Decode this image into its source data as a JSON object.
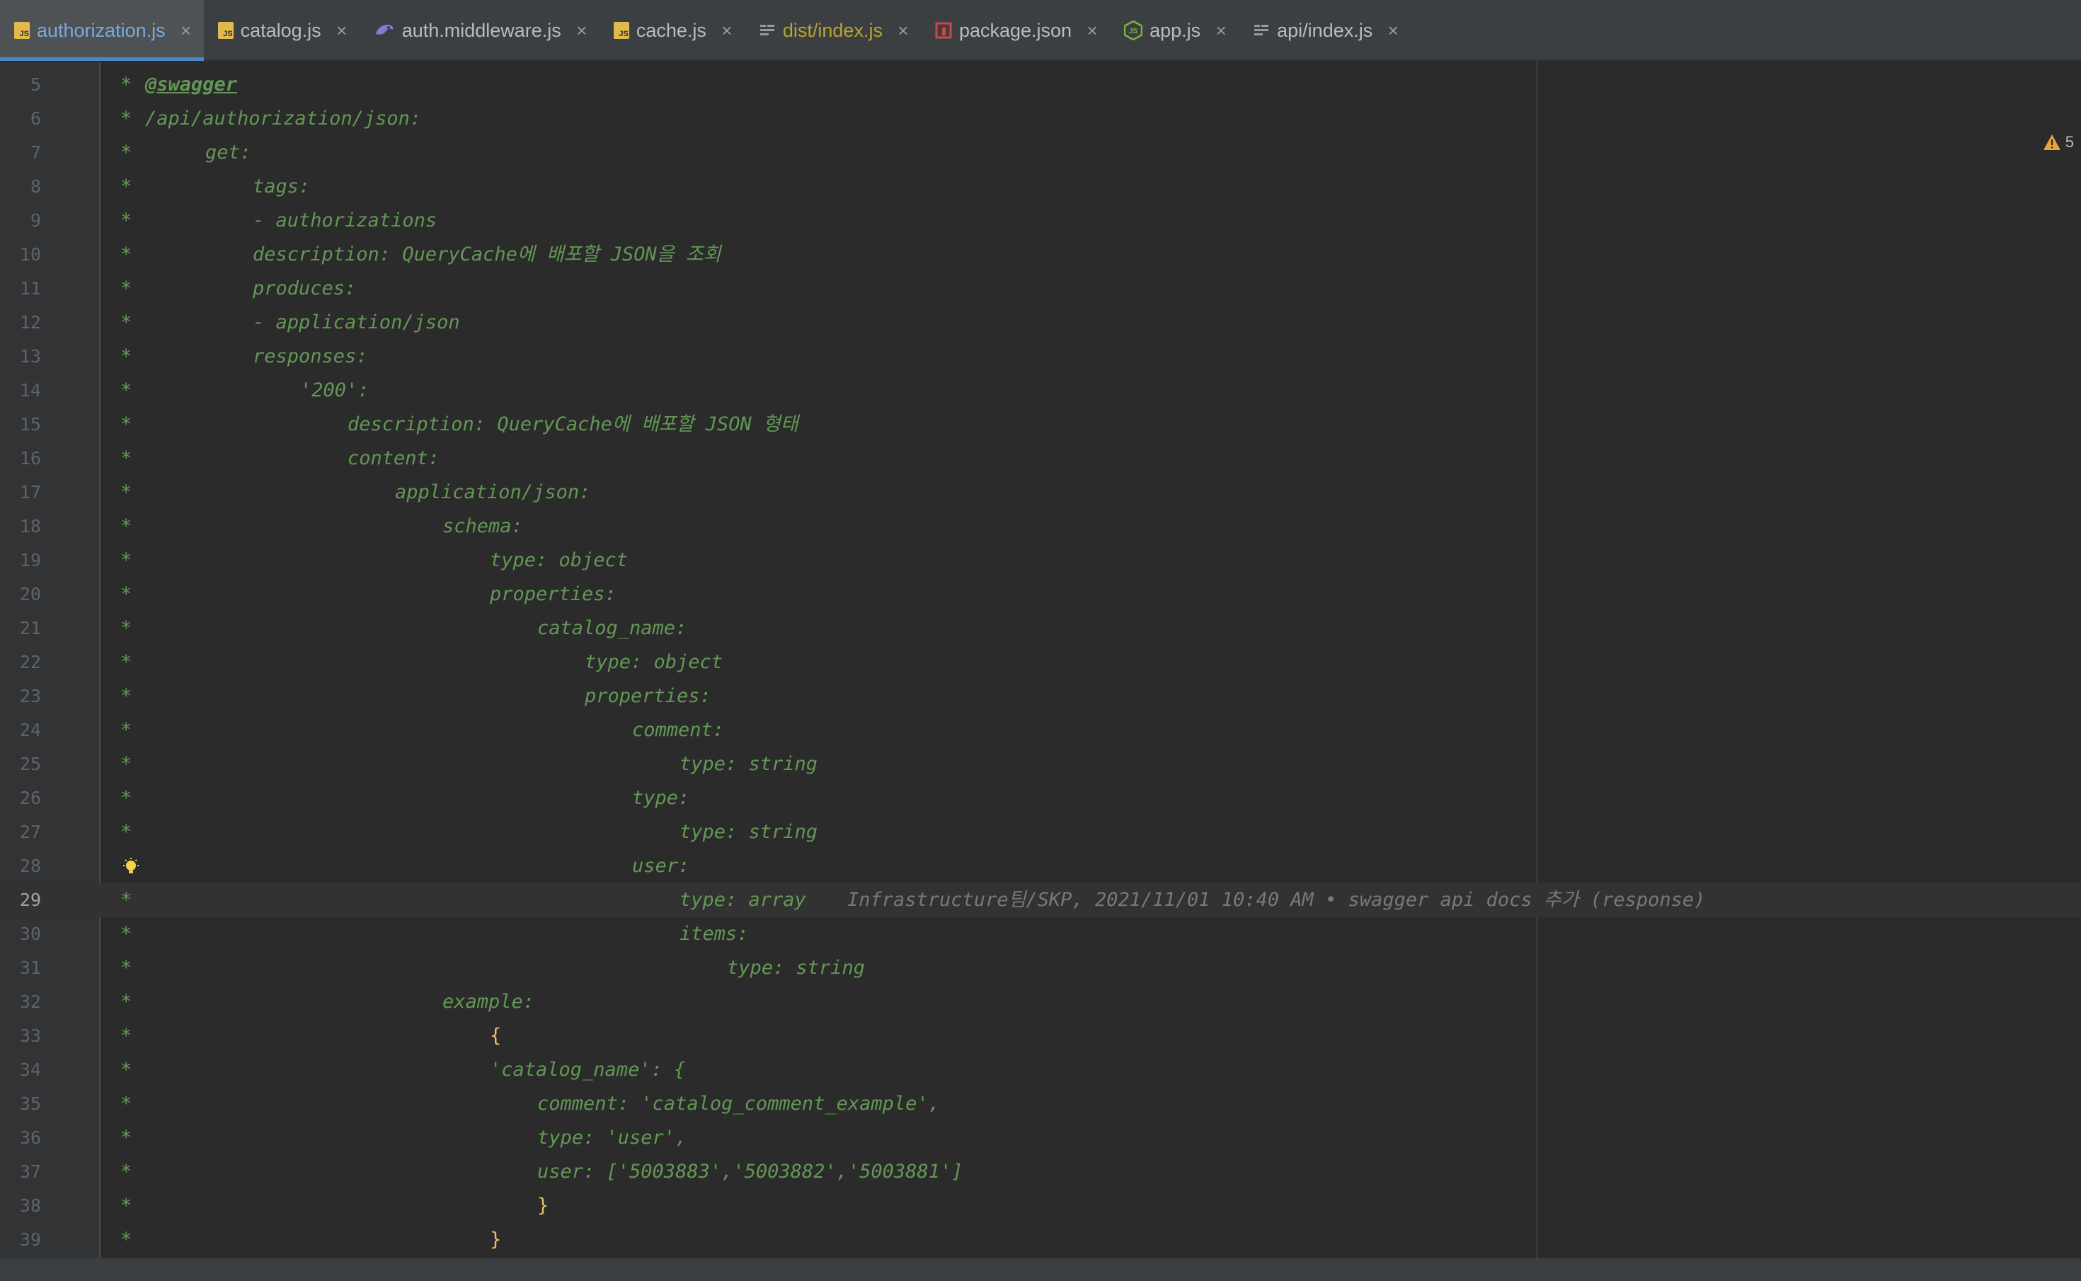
{
  "tabs": [
    {
      "label": "authorization.js",
      "icon": "js-file-icon",
      "active": true
    },
    {
      "label": "catalog.js",
      "icon": "js-file-icon"
    },
    {
      "label": "auth.middleware.js",
      "icon": "middleware-icon"
    },
    {
      "label": "cache.js",
      "icon": "js-file-icon"
    },
    {
      "label": "dist/index.js",
      "icon": "compiled-file-icon"
    },
    {
      "label": "package.json",
      "icon": "npm-icon"
    },
    {
      "label": "app.js",
      "icon": "nodejs-icon"
    },
    {
      "label": "api/index.js",
      "icon": "compiled-file-icon"
    }
  ],
  "tab_close_glyph": "×",
  "warnings": {
    "count": "5",
    "icon": "warning-icon"
  },
  "editor": {
    "current_line": "29",
    "blame": "Infrastructure팀/SKP, 2021/11/01 10:40 AM • swagger api docs 추가 (response)",
    "lines": [
      {
        "n": "5",
        "star": "*",
        "text": "@swagger"
      },
      {
        "n": "6",
        "star": "*",
        "text": "/api/authorization/json:"
      },
      {
        "n": "7",
        "star": "*",
        "text": "get:"
      },
      {
        "n": "8",
        "star": "*",
        "text": "tags:"
      },
      {
        "n": "9",
        "star": "*",
        "text": "- authorizations"
      },
      {
        "n": "10",
        "star": "*",
        "text": "description: QueryCache에 배포할 JSON을 조회"
      },
      {
        "n": "11",
        "star": "*",
        "text": "produces:"
      },
      {
        "n": "12",
        "star": "*",
        "text": "- application/json"
      },
      {
        "n": "13",
        "star": "*",
        "text": "responses:"
      },
      {
        "n": "14",
        "star": "*",
        "text": "'200':"
      },
      {
        "n": "15",
        "star": "*",
        "text": "description: QueryCache에 배포할 JSON 형태"
      },
      {
        "n": "16",
        "star": "*",
        "text": "content:"
      },
      {
        "n": "17",
        "star": "*",
        "text": "application/json:"
      },
      {
        "n": "18",
        "star": "*",
        "text": "schema:"
      },
      {
        "n": "19",
        "star": "*",
        "text": "type: object"
      },
      {
        "n": "20",
        "star": "*",
        "text": "properties:"
      },
      {
        "n": "21",
        "star": "*",
        "text": "catalog_name:"
      },
      {
        "n": "22",
        "star": "*",
        "text": "type: object"
      },
      {
        "n": "23",
        "star": "*",
        "text": "properties:"
      },
      {
        "n": "24",
        "star": "*",
        "text": "comment:"
      },
      {
        "n": "25",
        "star": "*",
        "text": "type: string"
      },
      {
        "n": "26",
        "star": "*",
        "text": "type:"
      },
      {
        "n": "27",
        "star": "*",
        "text": "type: string"
      },
      {
        "n": "28",
        "star": "",
        "text": "user:"
      },
      {
        "n": "29",
        "star": "*",
        "text": "type: array"
      },
      {
        "n": "30",
        "star": "*",
        "text": "items:"
      },
      {
        "n": "31",
        "star": "*",
        "text": "type: string"
      },
      {
        "n": "32",
        "star": "*",
        "text": "example:"
      },
      {
        "n": "33",
        "star": "*",
        "text": "{"
      },
      {
        "n": "34",
        "star": "*",
        "text": "'catalog_name': {"
      },
      {
        "n": "35",
        "star": "*",
        "text": "comment: 'catalog_comment_example',"
      },
      {
        "n": "36",
        "star": "*",
        "text": "type: 'user',"
      },
      {
        "n": "37",
        "star": "*",
        "text": "user: ['5003883','5003882','5003881']"
      },
      {
        "n": "38",
        "star": "*",
        "text": "}"
      },
      {
        "n": "39",
        "star": "*",
        "text": "}"
      }
    ]
  }
}
